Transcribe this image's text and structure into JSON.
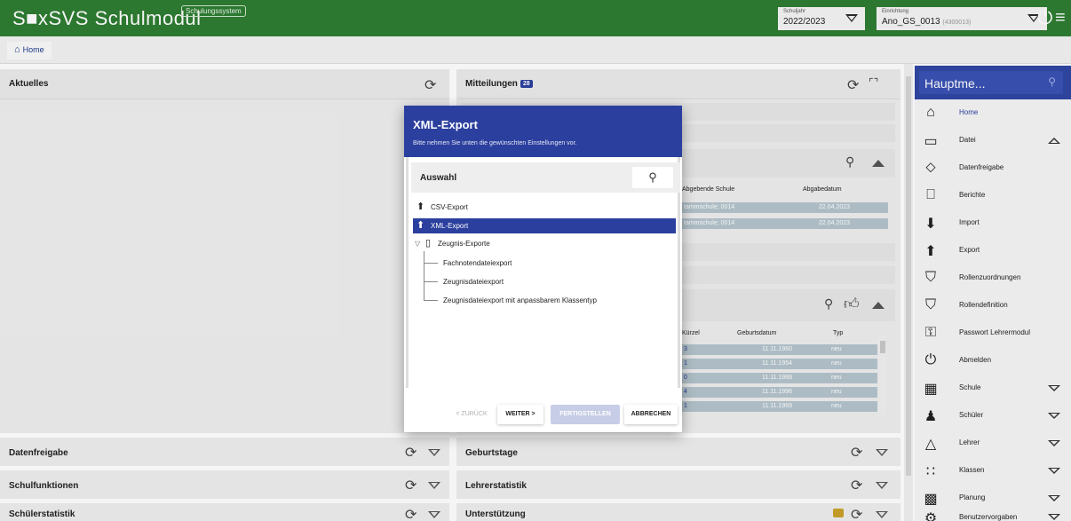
{
  "header": {
    "app_title": "S■xSVS Schulmodul",
    "system_badge": "Schulungssystem",
    "schuljahr": {
      "caption": "Schuljahr",
      "value": "2022/2023"
    },
    "einrichtung": {
      "caption": "Einrichtung",
      "value": "Ano_GS_0013",
      "code": "(4300013)"
    },
    "power_icon": "⏻",
    "menu_icon": "≡"
  },
  "breadcrumb": {
    "home_label": "Home"
  },
  "panels": {
    "aktuelles": {
      "title": "Aktuelles"
    },
    "mitteilungen": {
      "title": "Mitteilungen",
      "count": "28"
    },
    "datenfreigabe": {
      "title": "Datenfreigabe"
    },
    "geburtstage": {
      "title": "Geburtstage"
    },
    "schulfunktionen": {
      "title": "Schulfunktionen"
    },
    "lehrerstatistik": {
      "title": "Lehrerstatistik"
    },
    "schuelerstatistik": {
      "title": "Schülerstatistik"
    },
    "unterstuetzung": {
      "title": "Unterstützung"
    }
  },
  "table1": {
    "headers": [
      "Abgebende Schule",
      "Abgabedatum"
    ],
    "rows": [
      [
        "tammschule; 0014",
        "22.04.2023"
      ],
      [
        "tammschule; 0014",
        "22.04.2023"
      ]
    ]
  },
  "table2": {
    "headers": [
      "Kürzel",
      "Geburtsdatum",
      "Typ"
    ],
    "rows": [
      [
        "3",
        "11.11.1960",
        "neu"
      ],
      [
        "1",
        "11.11.1954",
        "neu"
      ],
      [
        "0",
        "11.11.1988",
        "neu"
      ],
      [
        "4",
        "11.11.1996",
        "neu"
      ],
      [
        "1",
        "11.11.1969",
        "neu"
      ]
    ]
  },
  "sidebar": {
    "title": "Hauptme...",
    "items": [
      {
        "label": "Home",
        "icon": "⌂"
      },
      {
        "label": "Datei",
        "icon": "▭"
      },
      {
        "label": "Datenfreigabe",
        "icon": "⬦"
      },
      {
        "label": "Berichte",
        "icon": "⎕"
      },
      {
        "label": "Import",
        "icon": "⬇"
      },
      {
        "label": "Export",
        "icon": "⬆"
      },
      {
        "label": "Rollenzuordnungen",
        "icon": "⛉"
      },
      {
        "label": "Rollendefinition",
        "icon": "⛉"
      },
      {
        "label": "Passwort Lehrermodul",
        "icon": "⚿"
      },
      {
        "label": "Abmelden",
        "icon": "⏻"
      },
      {
        "label": "Schule",
        "icon": "▦"
      },
      {
        "label": "Schüler",
        "icon": "♟"
      },
      {
        "label": "Lehrer",
        "icon": "△"
      },
      {
        "label": "Klassen",
        "icon": "∷"
      },
      {
        "label": "Planung",
        "icon": "▩"
      },
      {
        "label": "Benutzervorgaben",
        "icon": "⚙"
      }
    ]
  },
  "dialog": {
    "title": "XML-Export",
    "subtitle": "Bitte nehmen Sie unten die gewünschten Einstellungen vor.",
    "selection_label": "Auswahl",
    "tree": [
      {
        "label": "CSV-Export",
        "icon": "⬆"
      },
      {
        "label": "XML-Export",
        "icon": "⬆"
      },
      {
        "label": "Zeugnis-Exporte",
        "icon": "▯"
      },
      {
        "label": "Fachnotendateiexport"
      },
      {
        "label": "Zeugnisdateiexport"
      },
      {
        "label": "Zeugnisdateiexport mit anpassbarem Klassentyp"
      }
    ],
    "buttons": {
      "back": "< ZURÜCK",
      "next": "WEITER >",
      "finish": "FERTIGSTELLEN",
      "cancel": "ABBRECHEN"
    }
  },
  "colors": {
    "header_green": "#2e7d32",
    "accent_blue": "#2b3f9e",
    "table_row": "#b5c4cc"
  }
}
